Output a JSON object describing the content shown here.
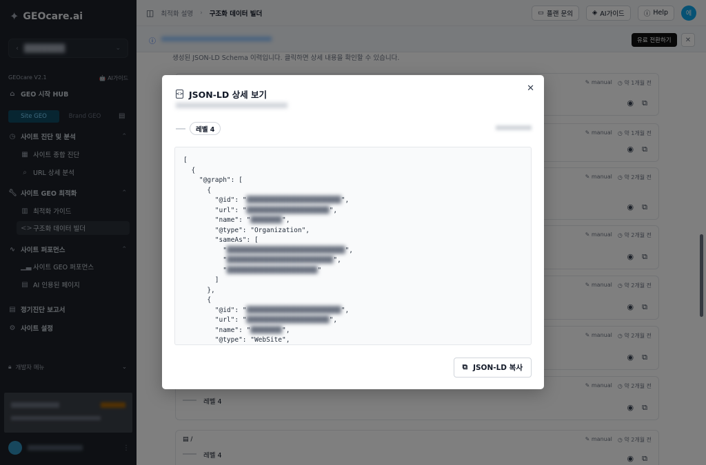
{
  "app": {
    "logo": "GEOcare.ai",
    "version": "GEOcare V2.1",
    "ai_guide_label": "AI가이드"
  },
  "sidebar": {
    "site_select": "███████",
    "hub": "GEO 시작 HUB",
    "segments": [
      "Site GEO",
      "Brand GEO"
    ],
    "sections": [
      {
        "label": "사이트 진단 및 분석",
        "items": [
          "사이트 종합 진단",
          "URL 상세 분석"
        ]
      },
      {
        "label": "사이트 GEO 최적화",
        "items": [
          "최적화 가이드",
          "구조화 데이터 빌더"
        ]
      },
      {
        "label": "사이트 퍼포먼스",
        "items": [
          "사이트 GEO 퍼포먼스",
          "AI 인용된 페이지"
        ]
      }
    ],
    "report": "정기진단 보고서",
    "settings": "사이트 설정",
    "dev_menu": "개발자 메뉴"
  },
  "topbar": {
    "breadcrumb": [
      "최적화 설명",
      "구조화 데이터 빌더"
    ],
    "plan_inquiry": "플랜 문의",
    "ai_guide": "AI가이드",
    "help": "Help",
    "avatar": "에"
  },
  "banner": {
    "upgrade": "유료 전환하기"
  },
  "main": {
    "description": "생성된 JSON-LD Schema 이력입니다. 클릭하면 상세 내용을 확인할 수 있습니다.",
    "cards": [
      {
        "tag": "manual",
        "time": "약 1개월 전"
      },
      {
        "tag": "manual",
        "time": "약 1개월 전"
      },
      {
        "tag": "manual",
        "time": "약 2개월 전"
      },
      {
        "tag": "manual",
        "time": "약 2개월 전"
      },
      {
        "tag": "manual",
        "time": "약 2개월 전"
      },
      {
        "tag": "manual",
        "time": "약 2개월 전"
      },
      {
        "tag": "manual",
        "time": "약 2개월 전",
        "title": "/",
        "level": "레벨 4"
      },
      {
        "tag": "manual",
        "time": "약 2개월 전",
        "title": "/",
        "level": "레벨 4"
      }
    ]
  },
  "modal": {
    "title": "JSON-LD 상세 보기",
    "level_badge": "레벨 4",
    "copy_button": "JSON-LD 복사",
    "code_lines": [
      "[",
      "  {",
      "    \"@graph\": [",
      "      {",
      "        \"@id\": \"",
      "        \"url\": \"",
      "        \"name\": \"",
      "        \"@type\": \"Organization\",",
      "        \"sameAs\": [",
      "          \"",
      "          \"",
      "          \"",
      "        ]",
      "      },",
      "      {",
      "        \"@id\": \"",
      "        \"url\": \"",
      "        \"name\": \"",
      "        \"@type\": \"WebSite\","
    ]
  },
  "colors": {
    "sidebar_bg": "#1c2128",
    "accent": "#0e4a63",
    "overlay": "rgba(0,0,0,0.5)"
  }
}
